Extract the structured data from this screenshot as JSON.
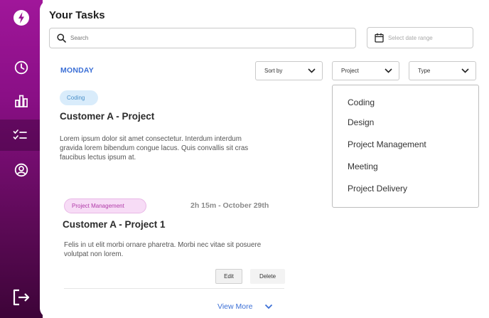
{
  "header": {
    "title": "Your Tasks"
  },
  "search": {
    "placeholder": "Search"
  },
  "date_range": {
    "placeholder": "Select date range"
  },
  "sidebar": {
    "items": [
      {
        "icon": "logo-icon"
      },
      {
        "icon": "clock-icon"
      },
      {
        "icon": "chart-icon"
      },
      {
        "icon": "task-list-icon",
        "active": true
      },
      {
        "icon": "user-icon"
      },
      {
        "icon": "logout-icon"
      }
    ]
  },
  "day": "MONDAY",
  "filters": {
    "sort_label": "Sort by",
    "project_label": "Project",
    "type_label": "Type"
  },
  "project_dropdown": {
    "options": [
      "Coding",
      "Design",
      "Project Management",
      "Meeting",
      "Project Delivery"
    ]
  },
  "tasks": [
    {
      "tag": "Coding",
      "title": "Customer A - Project",
      "description": "Lorem ipsum dolor sit amet consectetur. Interdum interdum gravida lorem bibendum congue lacus. Quis convallis sit cras faucibus lectus ipsum at."
    },
    {
      "tag": "Project Management",
      "time": "2h 15m - October 29th",
      "title": "Customer A - Project 1",
      "description": "Felis in ut elit morbi ornare pharetra. Morbi nec vitae sit posuere volutpat non lorem.",
      "edit_label": "Edit",
      "delete_label": "Delete"
    }
  ],
  "view_more": "View More",
  "colors": {
    "sidebar_top": "#a0169a",
    "sidebar_bottom": "#3d0438",
    "accent_blue": "#3b6fd6",
    "coding_tag_bg": "#d9ecfb",
    "pm_tag_bg": "#f7dcf6"
  }
}
